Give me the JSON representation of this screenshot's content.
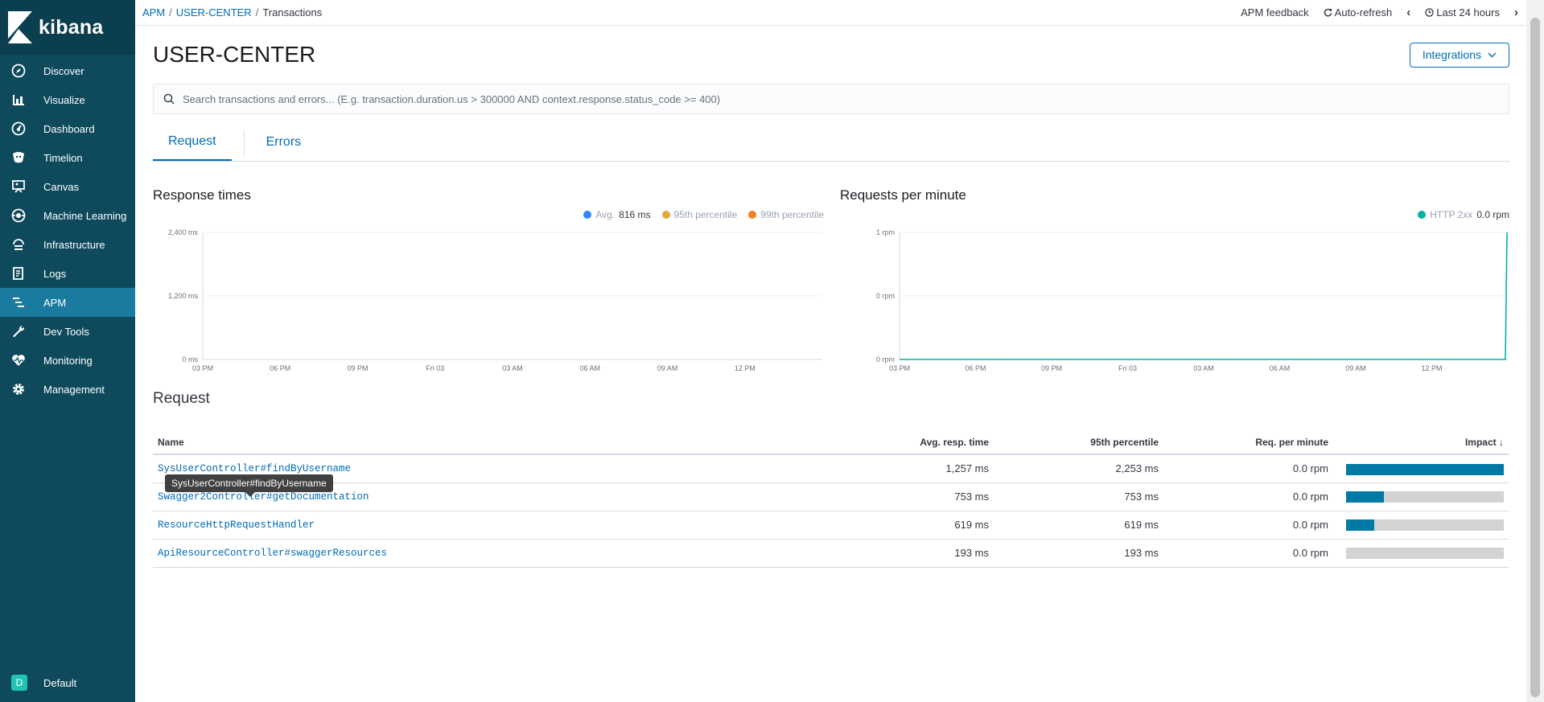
{
  "app": {
    "logo_text": "kibana"
  },
  "sidebar": {
    "items": [
      {
        "label": "Discover",
        "icon": "compass-icon"
      },
      {
        "label": "Visualize",
        "icon": "bar-chart-icon"
      },
      {
        "label": "Dashboard",
        "icon": "dashboard-icon"
      },
      {
        "label": "Timelion",
        "icon": "timelion-icon"
      },
      {
        "label": "Canvas",
        "icon": "canvas-icon"
      },
      {
        "label": "Machine Learning",
        "icon": "ml-icon"
      },
      {
        "label": "Infrastructure",
        "icon": "infrastructure-icon"
      },
      {
        "label": "Logs",
        "icon": "logs-icon"
      },
      {
        "label": "APM",
        "icon": "apm-icon",
        "active": true
      },
      {
        "label": "Dev Tools",
        "icon": "wrench-icon"
      },
      {
        "label": "Monitoring",
        "icon": "heartbeat-icon"
      },
      {
        "label": "Management",
        "icon": "gear-icon"
      }
    ],
    "space": {
      "initial": "D",
      "label": "Default"
    }
  },
  "topbar": {
    "breadcrumbs": [
      "APM",
      "USER-CENTER",
      "Transactions"
    ],
    "feedback": "APM feedback",
    "autorefresh": "Auto-refresh",
    "time_range": "Last 24 hours"
  },
  "page": {
    "title": "USER-CENTER",
    "integrations_label": "Integrations",
    "search_placeholder": "Search transactions and errors... (E.g. transaction.duration.us > 300000 AND context.response.status_code >= 400)",
    "tabs": [
      "Request",
      "Errors"
    ],
    "table_title": "Request",
    "tooltip": "SysUserController#findByUsername"
  },
  "colors": {
    "avg": "#3185fc",
    "p95": "#e6a73f",
    "p99": "#f3811e",
    "http2xx": "#00b3a4",
    "impact": "#0079a5"
  },
  "chart_data": [
    {
      "type": "line",
      "title": "Response times",
      "legend": [
        {
          "name": "Avg.",
          "value": "816 ms"
        },
        {
          "name": "95th percentile",
          "value": ""
        },
        {
          "name": "99th percentile",
          "value": ""
        }
      ],
      "y_ticks": [
        "2,400 ms",
        "1,200 ms",
        "0 ms"
      ],
      "x_ticks": [
        "03 PM",
        "06 PM",
        "09 PM",
        "Fri 03",
        "03 AM",
        "06 AM",
        "09 AM",
        "12 PM"
      ],
      "series": []
    },
    {
      "type": "line",
      "title": "Requests per minute",
      "legend": [
        {
          "name": "HTTP 2xx",
          "value": "0.0 rpm"
        }
      ],
      "y_ticks": [
        "1 rpm",
        "0 rpm",
        "0 rpm"
      ],
      "x_ticks": [
        "03 PM",
        "06 PM",
        "09 PM",
        "Fri 03",
        "03 AM",
        "06 AM",
        "09 AM",
        "12 PM"
      ],
      "series": [
        {
          "name": "HTTP 2xx",
          "note_values": [
            0,
            0,
            0,
            0,
            0,
            0,
            0,
            0,
            0,
            1
          ]
        }
      ]
    }
  ],
  "table": {
    "columns": [
      "Name",
      "Avg. resp. time",
      "95th percentile",
      "Req. per minute",
      "Impact"
    ],
    "rows": [
      {
        "name": "SysUserController#findByUsername",
        "avg": "1,257 ms",
        "p95": "2,253 ms",
        "rpm": "0.0 rpm",
        "impact": 1.0
      },
      {
        "name": "Swagger2Controller#getDocumentation",
        "avg": "753 ms",
        "p95": "753 ms",
        "rpm": "0.0 rpm",
        "impact": 0.24
      },
      {
        "name": "ResourceHttpRequestHandler",
        "avg": "619 ms",
        "p95": "619 ms",
        "rpm": "0.0 rpm",
        "impact": 0.18
      },
      {
        "name": "ApiResourceController#swaggerResources",
        "avg": "193 ms",
        "p95": "193 ms",
        "rpm": "0.0 rpm",
        "impact": 0.0
      }
    ]
  }
}
